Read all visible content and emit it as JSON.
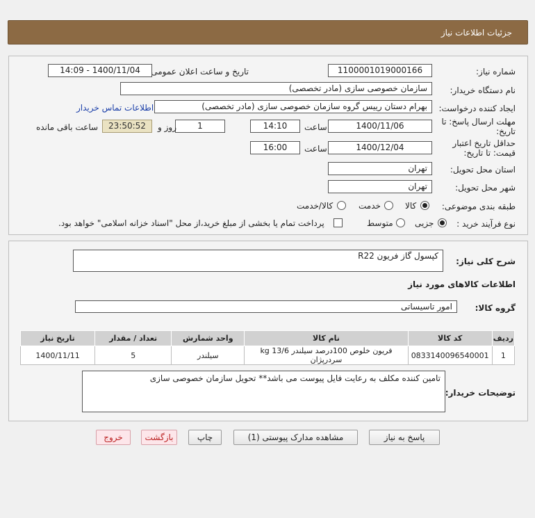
{
  "header": {
    "title": "جزئیات اطلاعات نیاز"
  },
  "form": {
    "need_number_label": "شماره نیاز:",
    "need_number": "1100001019000166",
    "announce_label": "تاریخ و ساعت اعلان عمومی:",
    "announce_value": "1400/11/04 - 14:09",
    "buyer_org_label": "نام دستگاه خریدار:",
    "buyer_org": "سازمان خصوصی سازی (مادر تخصصی)",
    "creator_label": "ایجاد کننده درخواست:",
    "creator": "بهرام دستان رییس گروه سازمان خصوصی سازی (مادر تخصصی)",
    "contact_link": "اطلاعات تماس خریدار",
    "deadline_label_1": "مهلت ارسال پاسخ: تا",
    "deadline_label_2": "تاریخ:",
    "deadline_date": "1400/11/06",
    "time_label": "ساعت",
    "deadline_time": "14:10",
    "days_value": "1",
    "days_label": "روز و",
    "remaining_time": "23:50:52",
    "remaining_label": "ساعت باقی مانده",
    "validity_label_1": "حداقل تاریخ اعتبار",
    "validity_label_2": "قیمت: تا تاریخ:",
    "validity_date": "1400/12/04",
    "validity_time": "16:00",
    "province_label": "استان محل تحویل:",
    "province": "تهران",
    "city_label": "شهر محل تحویل:",
    "city": "تهران",
    "category_label": "طبقه بندی موضوعی:",
    "category_options": [
      "کالا",
      "خدمت",
      "کالا/خدمت"
    ],
    "process_label": "نوع فرآیند خرید :",
    "process_options": [
      "جزیی",
      "متوسط"
    ],
    "payment_note": "پرداخت تمام یا بخشی از مبلغ خرید،از محل \"اسناد خزانه اسلامی\" خواهد بود."
  },
  "description": {
    "label": "شرح کلی نیاز:",
    "value": "کپسول گاز فریون R22"
  },
  "goods": {
    "section_title": "اطلاعات کالاهای مورد نیاز",
    "group_label": "گروه کالا:",
    "group_value": "امور تاسیساتی",
    "columns": [
      "ردیف",
      "کد کالا",
      "نام کالا",
      "واحد شمارش",
      "تعداد / مقدار",
      "تاریخ نیاز"
    ],
    "rows": [
      [
        "1",
        "0833140096540001",
        "فریون خلوص 100درصد سیلندر 13/6 kg سردرپژان",
        "سیلندر",
        "5",
        "1400/11/11"
      ]
    ]
  },
  "buyer_notes": {
    "label": "توضیحات خریدار:",
    "value": "تامین کننده مکلف به رعایت فایل پیوست می باشد** تحویل سازمان خصوصی سازی"
  },
  "buttons": {
    "reply": "پاسخ به نیاز",
    "attachments": "مشاهده مدارک پیوستی (1)",
    "print": "چاپ",
    "back": "بازگشت",
    "exit": "خروج"
  }
}
